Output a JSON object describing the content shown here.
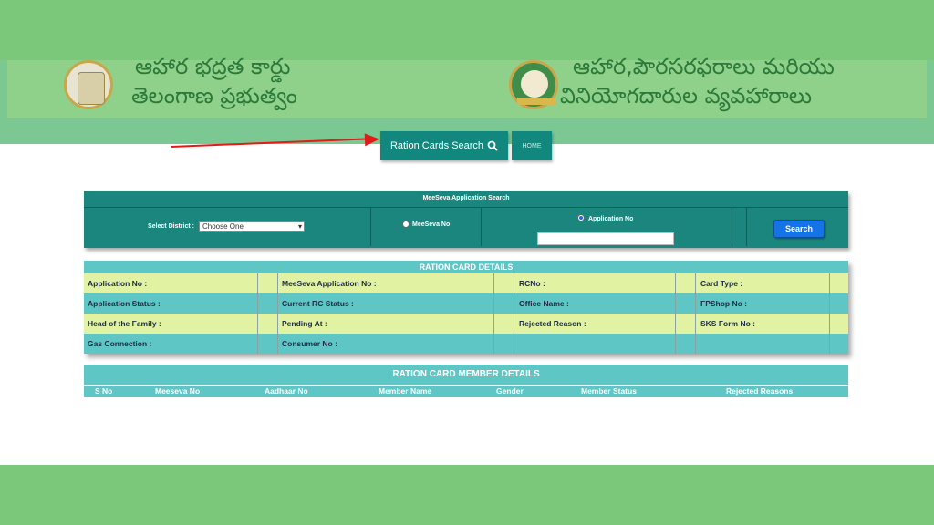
{
  "header": {
    "left_title_line1": "ఆహార భద్రత కార్డు",
    "left_title_line2": "తెలంగాణ ప్రభుత్వం",
    "right_title_line1": "ఆహార,పౌరసరఫరాలు మరియు",
    "right_title_line2": "వినియోగదారుల వ్యవహారాలు"
  },
  "nav": {
    "ration_cards_search_label": "Ration Cards Search",
    "home_label": "HOME"
  },
  "search": {
    "title": "MeeSeva Application Search",
    "district_label": "Select District :",
    "district_selected": "Choose One",
    "option_meeseva": "MeeSeva No",
    "option_application": "Application No",
    "selected_option": "Application No",
    "application_input_value": "",
    "search_button": "Search"
  },
  "details": {
    "title": "RATION CARD DETAILS",
    "rows": [
      [
        "Application No :",
        "MeeSeva Application No :",
        "RCNo :",
        "Card Type :"
      ],
      [
        "Application Status :",
        "Current RC Status :",
        "Office Name :",
        "FPShop No :"
      ],
      [
        "Head of the Family :",
        "Pending At :",
        "Rejected Reason :",
        "SKS Form No :"
      ],
      [
        "Gas Connection :",
        "Consumer No :",
        "",
        ""
      ]
    ]
  },
  "members": {
    "title": "RATION CARD MEMBER DETAILS",
    "columns": [
      "S No",
      "Meeseva No",
      "Aadhaar No",
      "Member Name",
      "Gender",
      "Member Status",
      "Rejected Reasons"
    ]
  },
  "colors": {
    "band": "#7bc87b",
    "header_bg": "#8fd08a",
    "teal_dark": "#1a867d",
    "teal_light": "#5ec7c6",
    "row_yellow": "#e1f2a3",
    "arrow": "#e11a1a",
    "search_button": "#1473e6"
  },
  "icons": {
    "search": "magnifier-icon",
    "dropdown": "chevron-down-icon"
  }
}
